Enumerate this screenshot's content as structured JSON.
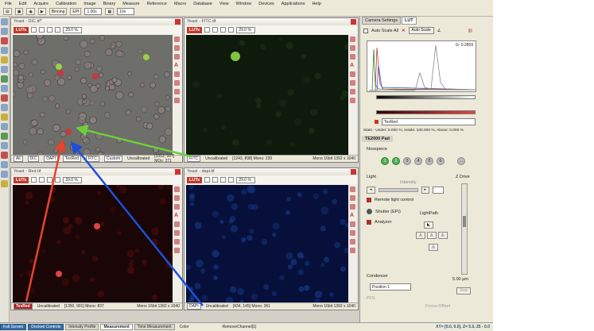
{
  "menu": [
    "File",
    "Edit",
    "Acquire",
    "Calibration",
    "Image",
    "Binary",
    "Measure",
    "Reference",
    "Macro",
    "Database",
    "View",
    "Window",
    "Devices",
    "Applications",
    "Help"
  ],
  "toolbar": {
    "binning_label": "Binning",
    "epi_label": "EPI",
    "exposure_value": "1.00s",
    "zoom_value": "10x"
  },
  "docs": [
    {
      "title": "Yeast - DIC.tif*",
      "luts": "LUTs",
      "zoom": "29.0 %",
      "status": "[1312, 107] MOs: 271",
      "calib": "Uncalibrated",
      "channels": [
        "All",
        "DIC",
        "DAPI",
        "TexRed",
        "FITC",
        "Custom"
      ]
    },
    {
      "title": "Yeast - FITC.tif",
      "luts": "LUTs",
      "zoom": "29.0 %",
      "status": "[1243, 898] Mono: 230",
      "calib": "Uncalibrated",
      "channel": "FITC",
      "info": "Mono 16bit 1392 x 1040"
    },
    {
      "title": "Yeast - Red.tif",
      "luts": "LUTs",
      "zoom": "29.0 %",
      "status": "[1350, 991] Mono: 837",
      "calib": "Uncalibrated",
      "channel": "TexRed",
      "info": "Mono 16bit 1392 x 1040"
    },
    {
      "title": "Yeast - dapi.tif",
      "luts": "LUTs",
      "zoom": "29.0 %",
      "status": "[434, 145] Mono: 361",
      "calib": "Uncalibrated",
      "channel": "DAPI",
      "info": "Mono 16bit 1392 x 1040"
    }
  ],
  "right": {
    "tabs": [
      "Camera Settings",
      "LUT"
    ],
    "auto_scale_all": "Auto Scale All",
    "auto_scale": "Auto Scale",
    "gamma": "G: 0.2859",
    "channel_select": "TexRed",
    "stats": "Stats - Under: 0.000 %, Inside: 100.000 %, Above: 0.000 %",
    "pad_title": "TE2000 Pad",
    "nosepiece": "Nosepiece",
    "nose_positions": [
      "1",
      "2",
      "3",
      "4",
      "5",
      "6"
    ],
    "light": "Light",
    "intensity": "Intensity",
    "remote_light": "Remote light control",
    "shutter": "Shutter (EPI)",
    "analyzer": "Analyzer",
    "lightpath": "LightPath",
    "zdrive": "Z Drive",
    "z_value": "5.00 µm",
    "condenser": "Condenser",
    "condenser_value": "Position 1",
    "pfs": "PFS",
    "pfs_off": "Focus Offset",
    "stop": "Stop"
  },
  "bottom": {
    "buttons": [
      "Full Screen",
      "Docked Controls",
      "Intensity Profile",
      "Measurement",
      "Time Measurement"
    ],
    "color_label": "Color",
    "remove_channel": "RemoveChannel[1]",
    "coords": "XY= [0.0, 0.0], Z= 5.0, 25 - 0.0"
  },
  "colors": {
    "accent_red": "#c0392b",
    "arrow_red": "#e8432e",
    "arrow_green": "#6ccf3a",
    "arrow_blue": "#1e4fd8"
  }
}
